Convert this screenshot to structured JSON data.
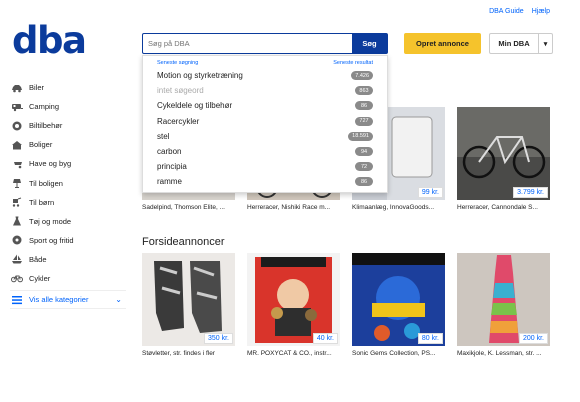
{
  "header": {
    "logo": "dba",
    "links": [
      "DBA Guide",
      "Hjælp"
    ],
    "search_placeholder": "Søg på DBA",
    "search_button": "Søg",
    "create_button": "Opret annonce",
    "mydba_button": "Min DBA"
  },
  "sidebar": {
    "items": [
      {
        "label": "Biler",
        "icon": "car-icon"
      },
      {
        "label": "Camping",
        "icon": "caravan-icon"
      },
      {
        "label": "Biltilbehør",
        "icon": "tire-icon"
      },
      {
        "label": "Boliger",
        "icon": "house-icon"
      },
      {
        "label": "Have og byg",
        "icon": "wheelbarrow-icon"
      },
      {
        "label": "Til boligen",
        "icon": "lamp-icon"
      },
      {
        "label": "Til børn",
        "icon": "stroller-icon"
      },
      {
        "label": "Tøj og mode",
        "icon": "dress-icon"
      },
      {
        "label": "Sport og fritid",
        "icon": "ball-icon"
      },
      {
        "label": "Både",
        "icon": "boat-icon"
      },
      {
        "label": "Cykler",
        "icon": "bicycle-icon"
      }
    ],
    "more": "Vis alle kategorier"
  },
  "suggestions": {
    "left_heading": "Seneste søgning",
    "right_heading": "Seneste resultat",
    "items": [
      {
        "label": "Motion og styrketræning",
        "count": "7.426",
        "muted": false
      },
      {
        "label": "intet søgeord",
        "count": "863",
        "muted": true
      },
      {
        "label": "Cykeldele og tilbehør",
        "count": "86",
        "muted": false
      },
      {
        "label": "Racercykler",
        "count": "727",
        "muted": false
      },
      {
        "label": "stel",
        "count": "18.591",
        "muted": false
      },
      {
        "label": "carbon",
        "count": "94",
        "muted": false
      },
      {
        "label": "principia",
        "count": "72",
        "muted": false
      },
      {
        "label": "ramme",
        "count": "86",
        "muted": false
      }
    ]
  },
  "top_row": [
    {
      "caption": "Sadelpind, Thomson Elite, ...",
      "price": ""
    },
    {
      "caption": "Herreracer, Nishiki Race m...",
      "price": ""
    },
    {
      "caption": "Klimaanlæg, InnovaGoods...",
      "price": "99 kr."
    },
    {
      "caption": "Herreracer, Cannondale S...",
      "price": "3.799 kr."
    }
  ],
  "featured": {
    "title": "Forsideannoncer",
    "items": [
      {
        "caption": "Støvletter, str. findes i fler",
        "price": "350 kr."
      },
      {
        "caption": "MR. POXYCAT & CO., instr...",
        "price": "40 kr."
      },
      {
        "caption": "Sonic Gems Collection, PS...",
        "price": "80 kr."
      },
      {
        "caption": "Maxikjole, K. Lessman, str. ...",
        "price": "200 kr."
      }
    ]
  },
  "colors": {
    "brand": "#0b3b9c",
    "accent": "#f5c32c",
    "link": "#0063fb"
  }
}
